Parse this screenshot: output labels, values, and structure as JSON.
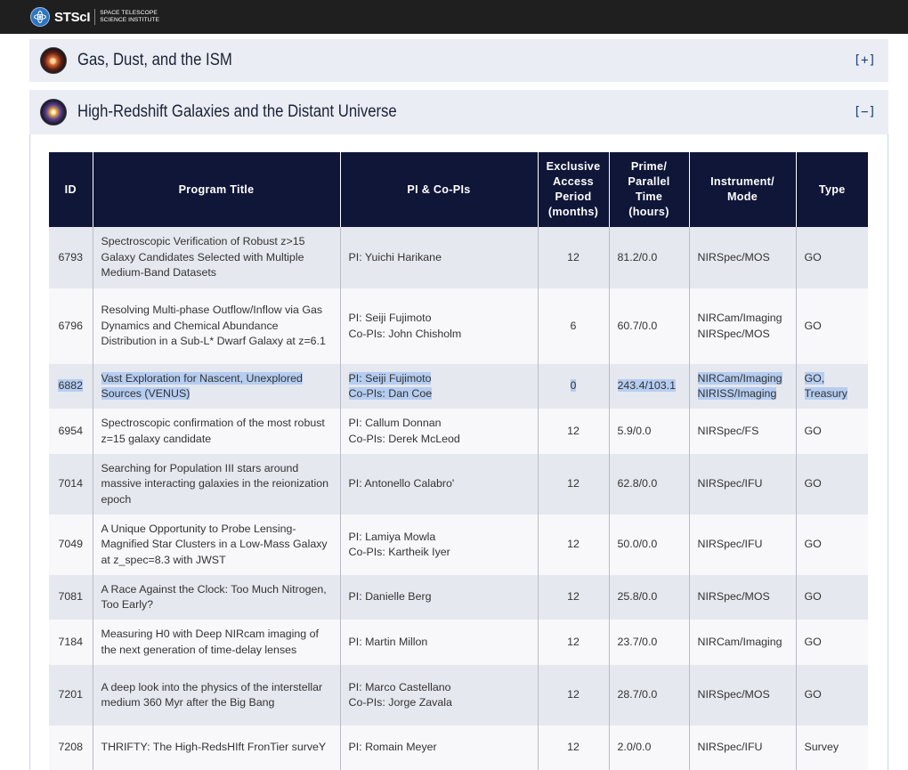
{
  "header": {
    "logo_text": "STScI",
    "logo_sub_line1": "SPACE TELESCOPE",
    "logo_sub_line2": "SCIENCE INSTITUTE"
  },
  "accordions": [
    {
      "title": "Gas, Dust, and the ISM",
      "toggle": "[+]"
    },
    {
      "title": "High-Redshift Galaxies and the Distant Universe",
      "toggle": "[−]"
    }
  ],
  "table": {
    "headers": {
      "id": "ID",
      "title": "Program Title",
      "pi": "PI & Co-PIs",
      "eap1": "Exclusive",
      "eap2": "Access",
      "eap3": "Period",
      "eap4": "(months)",
      "time1": "Prime/",
      "time2": "Parallel",
      "time3": "Time",
      "time4": "(hours)",
      "inst1": "Instrument/",
      "inst2": "Mode",
      "type": "Type"
    },
    "rows": [
      {
        "id": "6793",
        "title": "Spectroscopic Verification of Robust z>15 Galaxy Candidates Selected with Multiple Medium-Band Datasets",
        "pi": "PI: Yuichi Harikane",
        "copi": "",
        "eap": "12",
        "time": "81.2/0.0",
        "inst": "NIRSpec/MOS",
        "inst2": "",
        "type": "GO",
        "type2": ""
      },
      {
        "id": "6796",
        "title": "Resolving Multi-phase Outflow/Inflow via Gas Dynamics and Chemical Abundance Distribution in a Sub-L* Dwarf Galaxy at z=6.1",
        "pi": "PI: Seiji Fujimoto",
        "copi": "Co-PIs: John Chisholm",
        "eap": "6",
        "time": "60.7/0.0",
        "inst": "NIRCam/Imaging",
        "inst2": "NIRSpec/MOS",
        "type": "GO",
        "type2": ""
      },
      {
        "id": "6882",
        "title": "Vast Exploration for Nascent, Unexplored Sources (VENUS)",
        "pi": "PI: Seiji Fujimoto",
        "copi": "Co-PIs: Dan Coe",
        "eap": "0",
        "time": "243.4/103.1",
        "inst": "NIRCam/Imaging",
        "inst2": "NIRISS/Imaging",
        "type": "GO,",
        "type2": "Treasury"
      },
      {
        "id": "6954",
        "title": "Spectroscopic confirmation of the most robust z=15 galaxy candidate",
        "pi": "PI: Callum Donnan",
        "copi": "Co-PIs: Derek McLeod",
        "eap": "12",
        "time": "5.9/0.0",
        "inst": "NIRSpec/FS",
        "inst2": "",
        "type": "GO",
        "type2": ""
      },
      {
        "id": "7014",
        "title": "Searching for Population III stars around massive interacting galaxies in the reionization epoch",
        "pi": "PI: Antonello Calabro'",
        "copi": "",
        "eap": "12",
        "time": "62.8/0.0",
        "inst": "NIRSpec/IFU",
        "inst2": "",
        "type": "GO",
        "type2": ""
      },
      {
        "id": "7049",
        "title": "A Unique Opportunity to Probe Lensing-Magnified Star Clusters in a Low-Mass Galaxy at z_spec=8.3 with JWST",
        "pi": "PI: Lamiya Mowla",
        "copi": "Co-PIs: Kartheik Iyer",
        "eap": "12",
        "time": "50.0/0.0",
        "inst": "NIRSpec/IFU",
        "inst2": "",
        "type": "GO",
        "type2": ""
      },
      {
        "id": "7081",
        "title": "A Race Against the Clock: Too Much Nitrogen, Too Early?",
        "pi": "PI: Danielle Berg",
        "copi": "",
        "eap": "12",
        "time": "25.8/0.0",
        "inst": "NIRSpec/MOS",
        "inst2": "",
        "type": "GO",
        "type2": ""
      },
      {
        "id": "7184",
        "title": "Measuring H0 with Deep NIRcam imaging of the next generation of time-delay lenses",
        "pi": "PI: Martin Millon",
        "copi": "",
        "eap": "12",
        "time": "23.7/0.0",
        "inst": "NIRCam/Imaging",
        "inst2": "",
        "type": "GO",
        "type2": ""
      },
      {
        "id": "7201",
        "title": "A deep look into the physics of the interstellar medium 360 Myr after the Big Bang",
        "pi": "PI: Marco Castellano",
        "copi": "Co-PIs: Jorge Zavala",
        "eap": "12",
        "time": "28.7/0.0",
        "inst": "NIRSpec/MOS",
        "inst2": "",
        "type": "GO",
        "type2": ""
      },
      {
        "id": "7208",
        "title": "THRIFTY: The High-RedsHIft FronTier surveY",
        "pi": "PI: Romain Meyer",
        "copi": "",
        "eap": "12",
        "time": "2.0/0.0",
        "inst": "NIRSpec/IFU",
        "inst2": "",
        "type": "Survey",
        "type2": ""
      }
    ]
  }
}
